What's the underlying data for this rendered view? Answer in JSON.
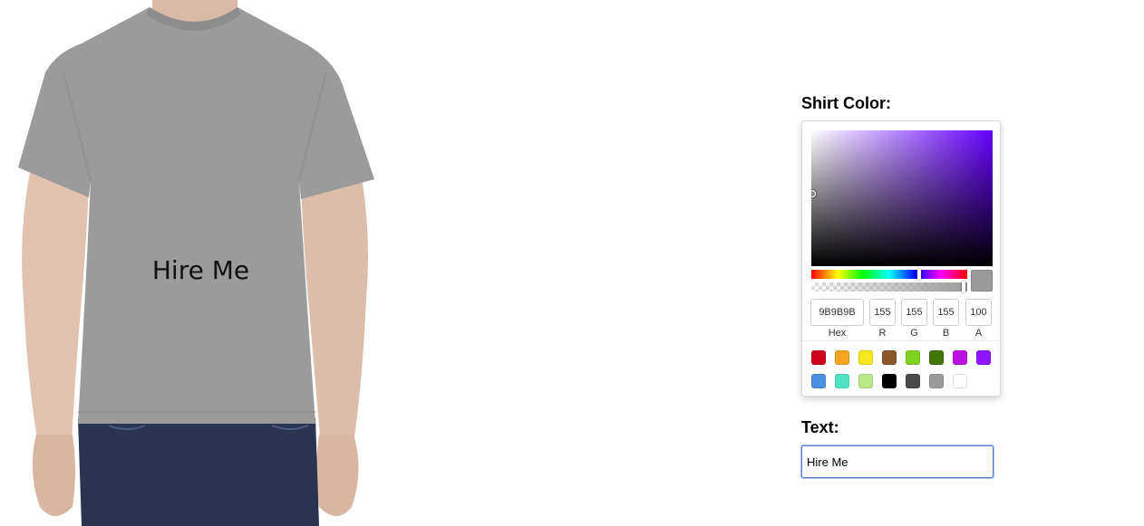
{
  "preview": {
    "shirt_text": "Hire Me",
    "shirt_color": "#9b9b9b"
  },
  "controls": {
    "shirt_color_label": "Shirt Color:",
    "text_label": "Text:",
    "text_value": "Hire Me"
  },
  "color_picker": {
    "hue_color": "#6600ff",
    "hex": "9B9B9B",
    "r": "155",
    "g": "155",
    "b": "155",
    "a": "100",
    "captions": {
      "hex": "Hex",
      "r": "R",
      "g": "G",
      "b": "B",
      "a": "A"
    },
    "presets": [
      "#d0021b",
      "#f5a623",
      "#f8e71c",
      "#8b572a",
      "#7ed321",
      "#417505",
      "#bd10e0",
      "#9013fe",
      "#4a90e2",
      "#50e3c2",
      "#b8e986",
      "#000000",
      "#4a4a4a",
      "#9b9b9b",
      "#ffffff"
    ]
  }
}
